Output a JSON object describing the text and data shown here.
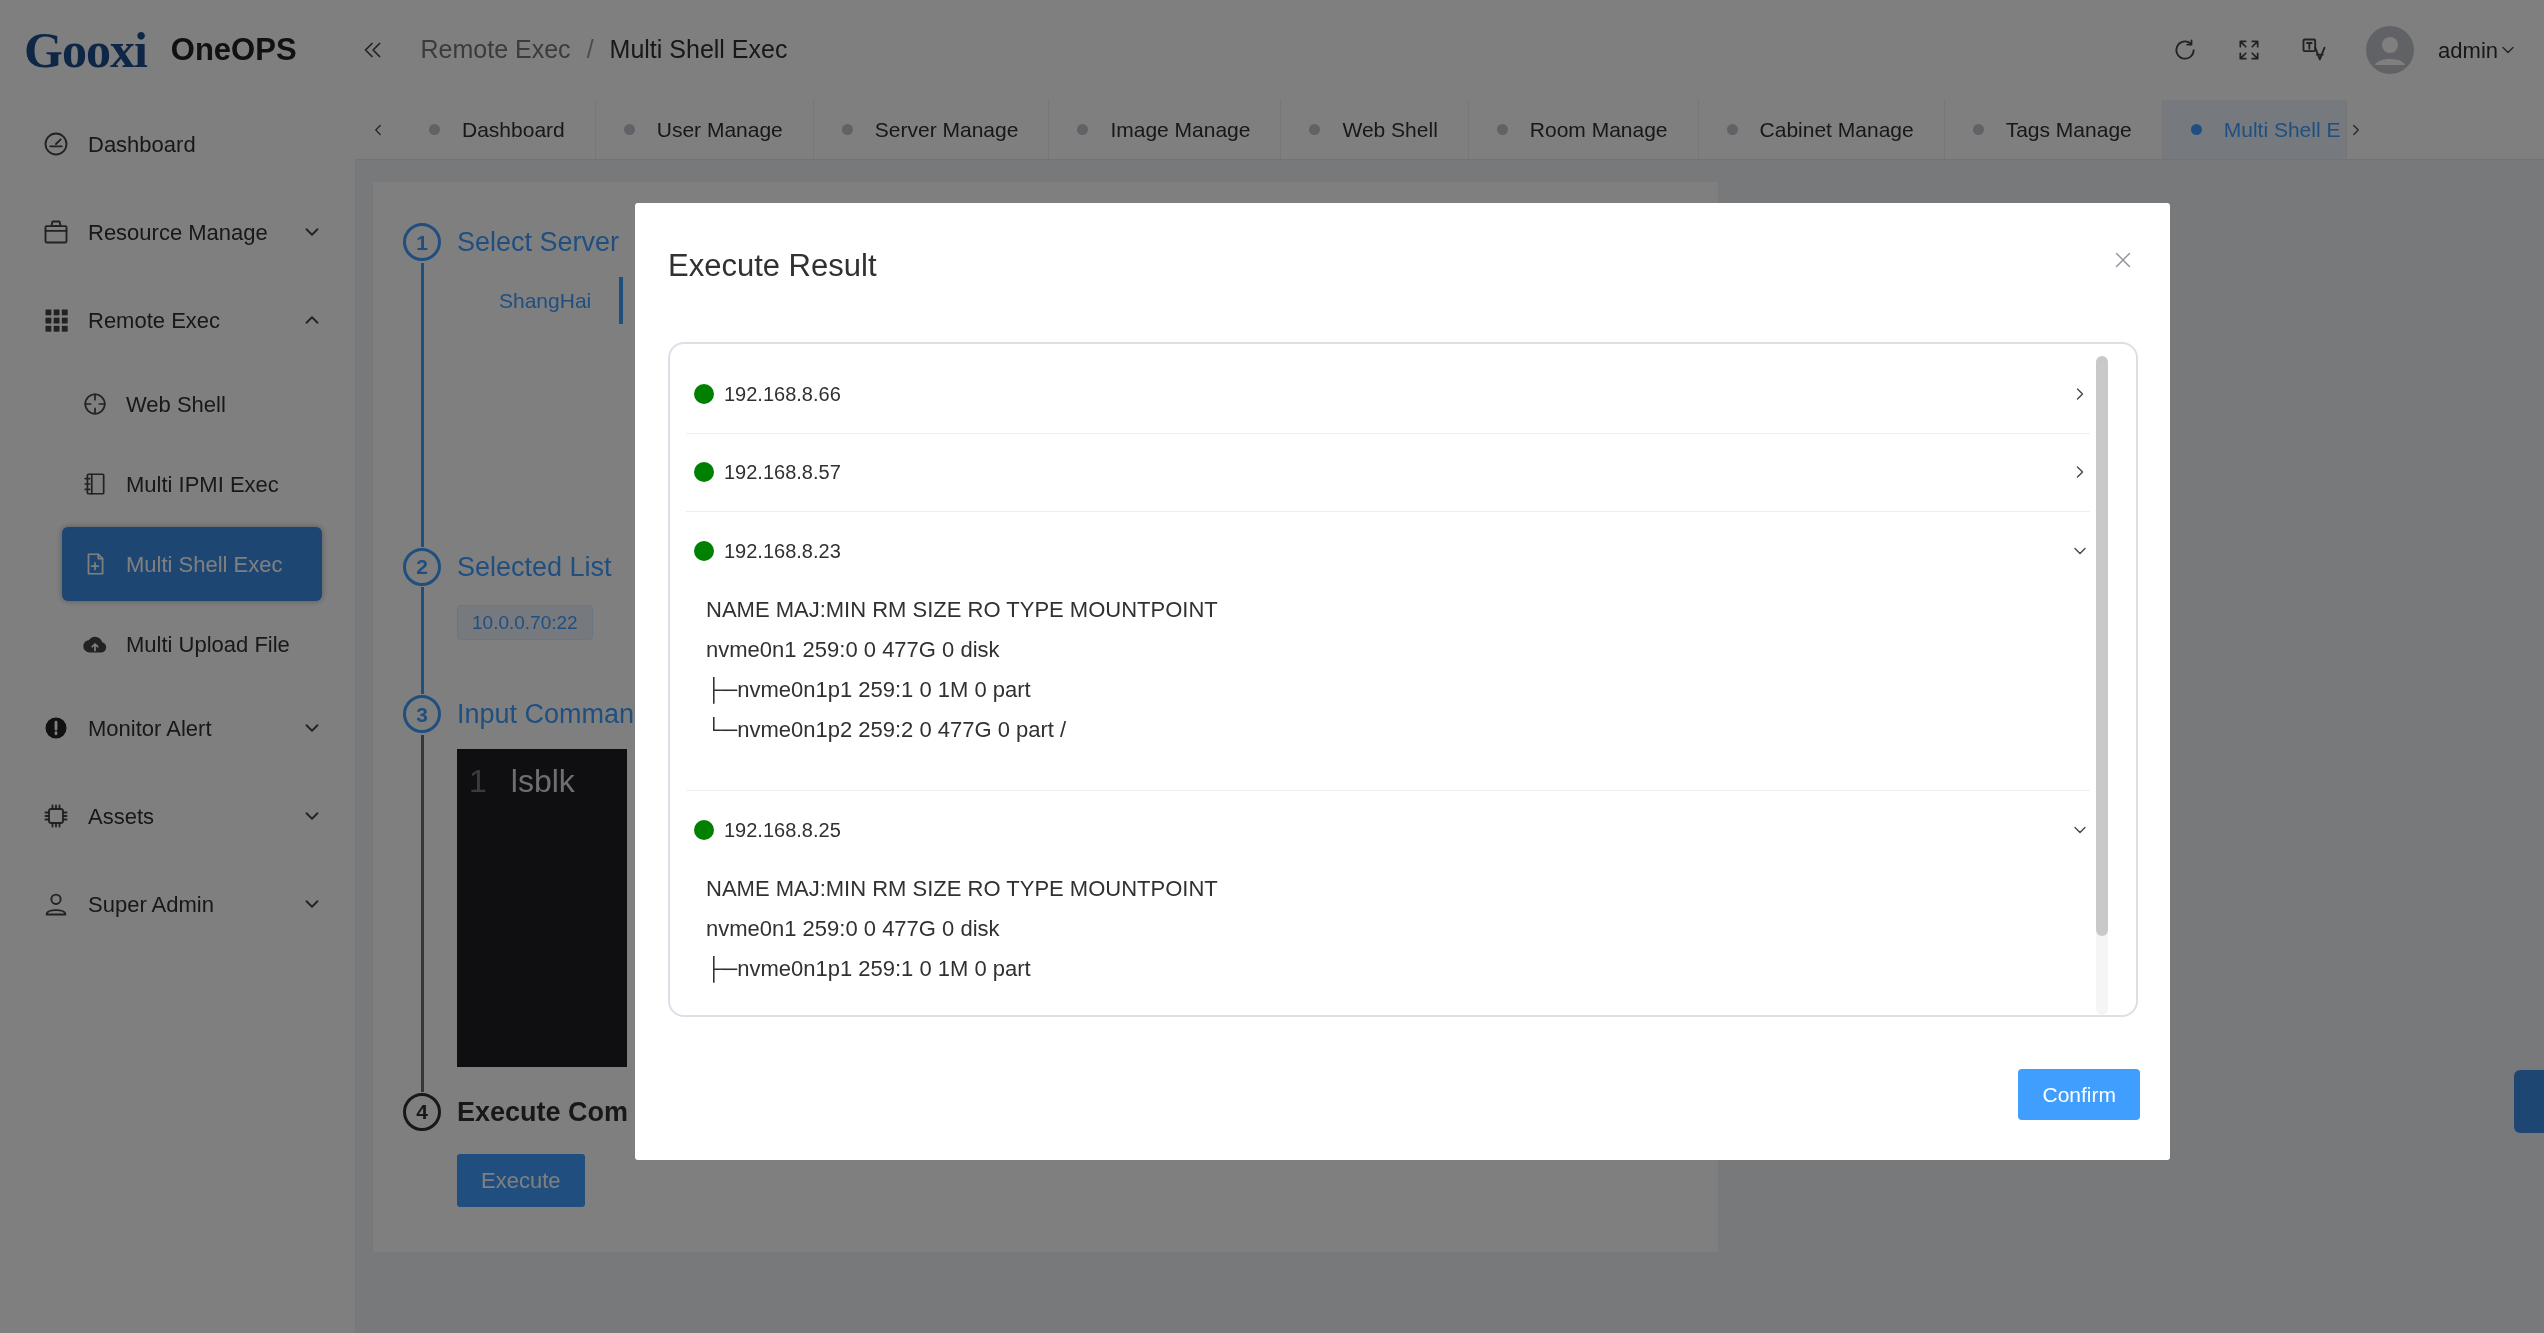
{
  "header": {
    "logo": "Gooxi",
    "app_name": "OneOPS",
    "breadcrumb": [
      "Remote Exec",
      "Multi Shell Exec"
    ],
    "breadcrumb_separator": "/",
    "user": "admin"
  },
  "sidebar": {
    "items": [
      {
        "label": "Dashboard",
        "kind": "link"
      },
      {
        "label": "Resource Manage",
        "kind": "group",
        "expanded": false
      },
      {
        "label": "Remote Exec",
        "kind": "group",
        "expanded": true,
        "children": [
          {
            "label": "Web Shell",
            "selected": false
          },
          {
            "label": "Multi IPMI Exec",
            "selected": false
          },
          {
            "label": "Multi Shell Exec",
            "selected": true
          },
          {
            "label": "Multi Upload File",
            "selected": false
          }
        ]
      },
      {
        "label": "Monitor Alert",
        "kind": "group",
        "expanded": false
      },
      {
        "label": "Assets",
        "kind": "group",
        "expanded": false
      },
      {
        "label": "Super Admin",
        "kind": "group",
        "expanded": false
      }
    ]
  },
  "tabs": [
    {
      "label": "Dashboard",
      "selected": false
    },
    {
      "label": "User Manage",
      "selected": false
    },
    {
      "label": "Server Manage",
      "selected": false
    },
    {
      "label": "Image Manage",
      "selected": false
    },
    {
      "label": "Web Shell",
      "selected": false
    },
    {
      "label": "Room Manage",
      "selected": false
    },
    {
      "label": "Cabinet Manage",
      "selected": false
    },
    {
      "label": "Tags Manage",
      "selected": false
    },
    {
      "label": "Multi Shell E",
      "selected": true
    }
  ],
  "steps": [
    {
      "number": "1",
      "title": "Select Server",
      "current": false,
      "kind": "regions",
      "regions": [
        {
          "label": "ShangHai",
          "selected": true
        }
      ]
    },
    {
      "number": "2",
      "title": "Selected List",
      "current": false,
      "kind": "tags",
      "tags": [
        "10.0.0.70:22"
      ]
    },
    {
      "number": "3",
      "title": "Input Comman",
      "current": false,
      "kind": "editor",
      "lines": [
        {
          "number": "1",
          "text": "lsblk"
        }
      ]
    },
    {
      "number": "4",
      "title": "Execute Com",
      "current": true,
      "kind": "button",
      "button": "Execute"
    }
  ],
  "modal": {
    "title": "Execute Result",
    "confirm": "Confirm",
    "results": [
      {
        "host": "192.168.8.66",
        "color": "#008000",
        "expanded": false
      },
      {
        "host": "192.168.8.57",
        "color": "#008000",
        "expanded": false
      },
      {
        "host": "192.168.8.23",
        "color": "#008000",
        "expanded": true,
        "output": [
          "NAME MAJ:MIN RM SIZE RO TYPE MOUNTPOINT",
          "nvme0n1 259:0 0 477G 0 disk",
          "├─nvme0n1p1 259:1 0 1M 0 part",
          "└─nvme0n1p2 259:2 0 477G 0 part /"
        ]
      },
      {
        "host": "192.168.8.25",
        "color": "#008000",
        "expanded": true,
        "output": [
          "NAME MAJ:MIN RM SIZE RO TYPE MOUNTPOINT",
          "nvme0n1 259:0 0 477G 0 disk",
          "├─nvme0n1p1 259:1 0 1M 0 part"
        ]
      }
    ]
  }
}
